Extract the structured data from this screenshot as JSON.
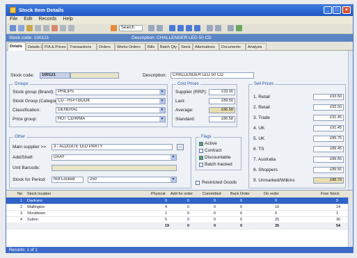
{
  "window": {
    "title": "Stock Item Details"
  },
  "titlebar_buttons": [
    "_",
    "□",
    "×"
  ],
  "menu": [
    "File",
    "Edit",
    "Records",
    "Help"
  ],
  "toolbar": {
    "search_label": "Search"
  },
  "infobar": {
    "left": "Stock code: 100121",
    "right": "Description: CHALLENGER LED 50 CD"
  },
  "tabs": [
    "Details",
    "Details 2",
    "P/A & Prices",
    "Transactions",
    "Orders",
    "Works Orders",
    "Bills",
    "Batch Qty",
    "Stock",
    "Alternatives",
    "Documents",
    "Analysis"
  ],
  "header": {
    "stock_code_label": "Stock code:",
    "stock_code": "100121",
    "description_label": "Description:",
    "description": "CHALLENGER LED 50 CD"
  },
  "groups_box": {
    "title": "Groups",
    "fields": [
      {
        "label": "Stock group (Brand):",
        "value": "PHILIPS"
      },
      {
        "label": "Stock Group (Category):",
        "value": "CD - HI-FI BOOK"
      },
      {
        "label": "Classification:",
        "value": "GENERAL"
      },
      {
        "label": "Price group:",
        "value": "HOT CD/WMA"
      }
    ]
  },
  "cost_prices": {
    "title": "Cost Prices",
    "rows": [
      {
        "label": "Supplier (RRP):",
        "value": "£33.00"
      },
      {
        "label": "Last:",
        "value": "£89.50"
      },
      {
        "label": "Average:",
        "value": "£86.58"
      },
      {
        "label": "Standard:",
        "value": "£86.58"
      }
    ]
  },
  "sell_prices": {
    "title": "Sell Prices",
    "rows": [
      {
        "label": "1. Retail",
        "value": "£93.50"
      },
      {
        "label": "2. Retail",
        "value": "£93.50"
      },
      {
        "label": "3. Trade",
        "value": "£91.45"
      },
      {
        "label": "4. UK",
        "value": "£91.45"
      },
      {
        "label": "5. UK",
        "value": "£89.75"
      },
      {
        "label": "6. TS",
        "value": "£89.45"
      },
      {
        "label": "7. Australia",
        "value": "£89.55"
      },
      {
        "label": "8. Shoppers",
        "value": "£89.55"
      },
      {
        "label": "9. Unmarked/Wilkins",
        "value": "£88.70"
      }
    ]
  },
  "other_box": {
    "title": "Other",
    "fields": [
      {
        "label": "Main supplier >>",
        "value": "3 - ALDGATE LED PARTY"
      },
      {
        "label": "Add/Shelf:",
        "value": "DAAY"
      },
      {
        "label": "Unit Barcode:",
        "value": ""
      },
      {
        "label": "Stock for Period:",
        "value": "Not Locked",
        "value2": "250"
      }
    ]
  },
  "flags": {
    "title": "Flags",
    "items": [
      {
        "label": "Active",
        "checked": true
      },
      {
        "label": "Contract",
        "checked": false
      },
      {
        "label": "Discountable",
        "checked": true
      },
      {
        "label": "Batch tracked",
        "checked": false
      }
    ],
    "restriction_label": "Restricted Goods"
  },
  "grid": {
    "headers": [
      "No",
      "Stock location",
      "Physical",
      "Add for order",
      "Committed",
      "Back Order",
      "On order",
      "Free Stock"
    ],
    "rows": [
      {
        "no": "1",
        "loc": "Davtrans",
        "phys": "9",
        "add": "0",
        "comm": "0",
        "back": "0",
        "ord": "0",
        "free": "9"
      },
      {
        "no": "2",
        "loc": "Wallington",
        "phys": "4",
        "add": "0",
        "comm": "0",
        "back": "0",
        "ord": "10",
        "free": "14"
      },
      {
        "no": "3",
        "loc": "Shrubtown",
        "phys": "1",
        "add": "0",
        "comm": "0",
        "back": "0",
        "ord": "0",
        "free": "1"
      },
      {
        "no": "4",
        "loc": "Sutton",
        "phys": "5",
        "add": "0",
        "comm": "0",
        "back": "0",
        "ord": "25",
        "free": "30"
      },
      {
        "no": "",
        "loc": "",
        "phys": "19",
        "add": "0",
        "comm": "0",
        "back": "0",
        "ord": "35",
        "free": "54"
      }
    ]
  },
  "status": {
    "text": "Records: 1 of 1"
  },
  "colors": {
    "titlebar": "#2a63d0",
    "selected_row": "#2f63c8",
    "infobar": "#5a84c4"
  }
}
